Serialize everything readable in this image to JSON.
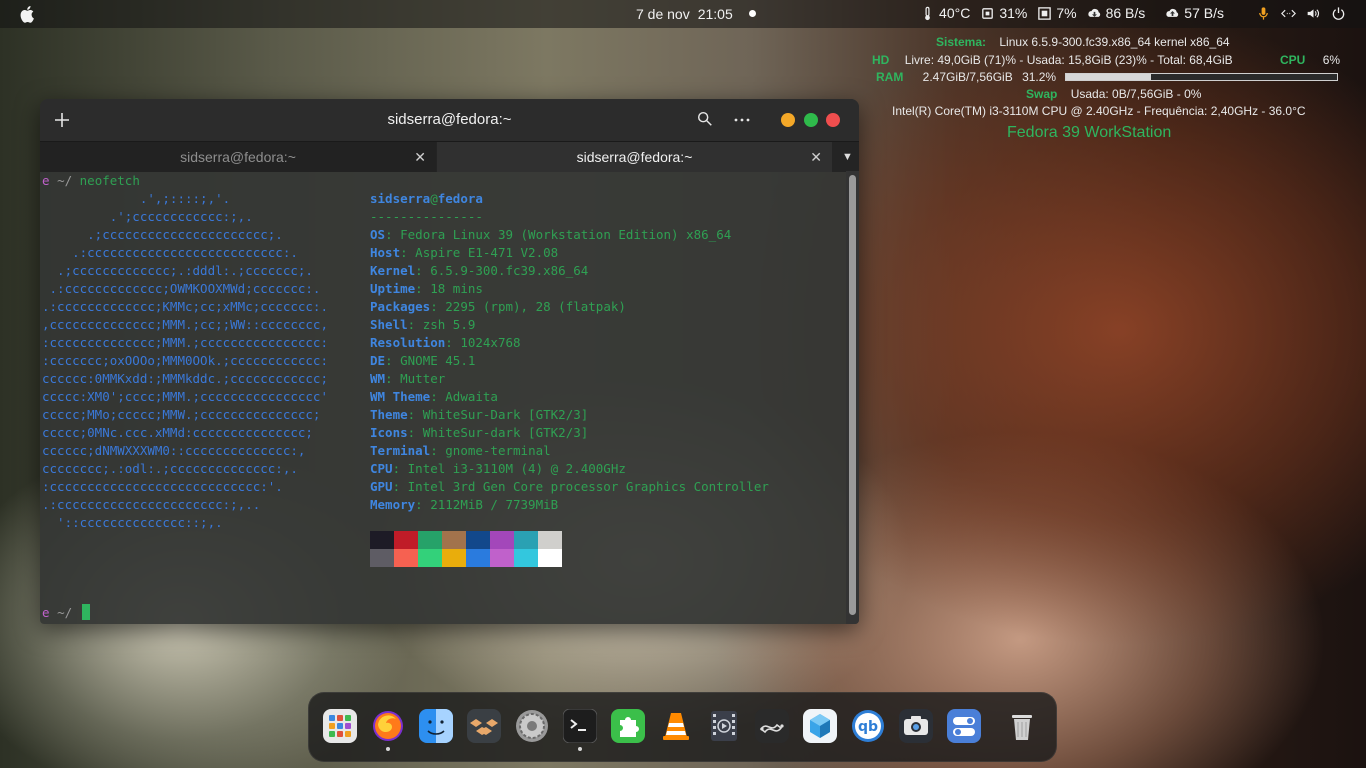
{
  "topbar": {
    "date": "7 de nov",
    "time": "21:05",
    "temp": "40°C",
    "cpu_usage": "31%",
    "mem_usage": "7%",
    "download": "86 B/s",
    "upload": "57 B/s"
  },
  "conky": {
    "sistema_label": "Sistema:",
    "sistema_value": "Linux 6.5.9-300.fc39.x86_64 kernel x86_64",
    "hd_label": "HD",
    "hd_value": "Livre: 49,0GiB (71)% - Usada: 15,8GiB (23)% - Total: 68,4GiB",
    "cpu_label": "CPU",
    "cpu_value": "6%",
    "ram_label": "RAM",
    "ram_value": "2.47GiB/7,56GiB",
    "ram_percent": "31.2%",
    "ram_fraction": 0.312,
    "swap_label": "Swap",
    "swap_value": "Usada:  0B/7,56GiB - 0%",
    "cpu_info": "Intel(R) Core(TM) i3-3110M CPU @ 2.40GHz - Frequência: 2,40GHz - 36.0°C",
    "distro": "Fedora 39 WorkStation",
    "accent": "#2fb55f"
  },
  "terminal": {
    "title": "sidserra@fedora:~",
    "tabs": [
      {
        "label": "sidserra@fedora:~",
        "active": false
      },
      {
        "label": "sidserra@fedora:~",
        "active": true
      }
    ],
    "prompt_symbol": "e",
    "prompt_dir": "~/",
    "command": "neofetch",
    "logo_lines": [
      "             .',;::::;,'.",
      "         .';cccccccccccc:;,.",
      "      .;cccccccccccccccccccccc;.",
      "    .:cccccccccccccccccccccccccc:.",
      "  .;ccccccccccccc;.:dddl:.;ccccccc;.",
      " .:ccccccccccccc;OWMKOOXMWd;ccccccc:.",
      ".:ccccccccccccc;KMMc;cc;xMMc;ccccccc:.",
      ",cccccccccccccc;MMM.;cc;;WW::cccccccc,",
      ":cccccccccccccc;MMM.;cccccccccccccccc:",
      ":ccccccc;oxOOOo;MMM0OOk.;cccccccccccc:",
      "cccccc:0MMKxdd:;MMMkddc.;cccccccccccc;",
      "ccccc:XM0';cccc;MMM.;cccccccccccccccc'",
      "ccccc;MMo;ccccc;MMW.;ccccccccccccccc;",
      "ccccc;0MNc.ccc.xMMd:ccccccccccccccc;",
      "cccccc;dNMWXXXWM0::cccccccccccccc:,",
      "cccccccc;.:odl:.;cccccccccccccc:,.",
      ":cccccccccccccccccccccccccccc:'.",
      ".:cccccccccccccccccccccc:;,..",
      "  '::cccccccccccccc::;,."
    ],
    "user": "sidserra",
    "at": "@",
    "host": "fedora",
    "separator": "---------------",
    "info": [
      {
        "key": "OS",
        "value": "Fedora Linux 39 (Workstation Edition) x86_64"
      },
      {
        "key": "Host",
        "value": "Aspire E1-471 V2.08"
      },
      {
        "key": "Kernel",
        "value": "6.5.9-300.fc39.x86_64"
      },
      {
        "key": "Uptime",
        "value": "18 mins"
      },
      {
        "key": "Packages",
        "value": "2295 (rpm), 28 (flatpak)"
      },
      {
        "key": "Shell",
        "value": "zsh 5.9"
      },
      {
        "key": "Resolution",
        "value": "1024x768"
      },
      {
        "key": "DE",
        "value": "GNOME 45.1"
      },
      {
        "key": "WM",
        "value": "Mutter"
      },
      {
        "key": "WM Theme",
        "value": "Adwaita"
      },
      {
        "key": "Theme",
        "value": "WhiteSur-Dark [GTK2/3]"
      },
      {
        "key": "Icons",
        "value": "WhiteSur-dark [GTK2/3]"
      },
      {
        "key": "Terminal",
        "value": "gnome-terminal"
      },
      {
        "key": "CPU",
        "value": "Intel i3-3110M (4) @ 2.400GHz"
      },
      {
        "key": "GPU",
        "value": "Intel 3rd Gen Core processor Graphics Controller"
      },
      {
        "key": "Memory",
        "value": "2112MiB / 7739MiB"
      }
    ],
    "palette_top": [
      "#1d1b26",
      "#c01c28",
      "#26a269",
      "#a2734c",
      "#12488b",
      "#a347ba",
      "#2aa1b3",
      "#d0cfcc"
    ],
    "palette_bottom": [
      "#5e5c64",
      "#f66151",
      "#33d17a",
      "#e9ad0c",
      "#2a7bde",
      "#c061cb",
      "#33c7de",
      "#ffffff"
    ]
  },
  "dock": {
    "apps": [
      {
        "name": "app-grid",
        "icon": "grid-icon",
        "running": false
      },
      {
        "name": "firefox",
        "icon": "firefox-icon",
        "running": true
      },
      {
        "name": "files",
        "icon": "finder-icon",
        "running": false
      },
      {
        "name": "dropbox",
        "icon": "dropbox-icon",
        "running": false
      },
      {
        "name": "settings",
        "icon": "settings-icon",
        "running": false
      },
      {
        "name": "terminal",
        "icon": "terminal-icon",
        "running": true
      },
      {
        "name": "extensions",
        "icon": "puzzle-icon",
        "running": false
      },
      {
        "name": "vlc",
        "icon": "vlc-icon",
        "running": false
      },
      {
        "name": "video-player",
        "icon": "film-icon",
        "running": false
      },
      {
        "name": "inkscape",
        "icon": "pen-icon",
        "running": false
      },
      {
        "name": "virtualbox",
        "icon": "cube-icon",
        "running": false
      },
      {
        "name": "qbittorrent",
        "icon": "qbittorrent-icon",
        "running": false
      },
      {
        "name": "screenshot",
        "icon": "camera-icon",
        "running": false
      },
      {
        "name": "tweaks",
        "icon": "toggles-icon",
        "running": false
      },
      {
        "name": "trash",
        "icon": "trash-icon",
        "running": false
      }
    ]
  }
}
